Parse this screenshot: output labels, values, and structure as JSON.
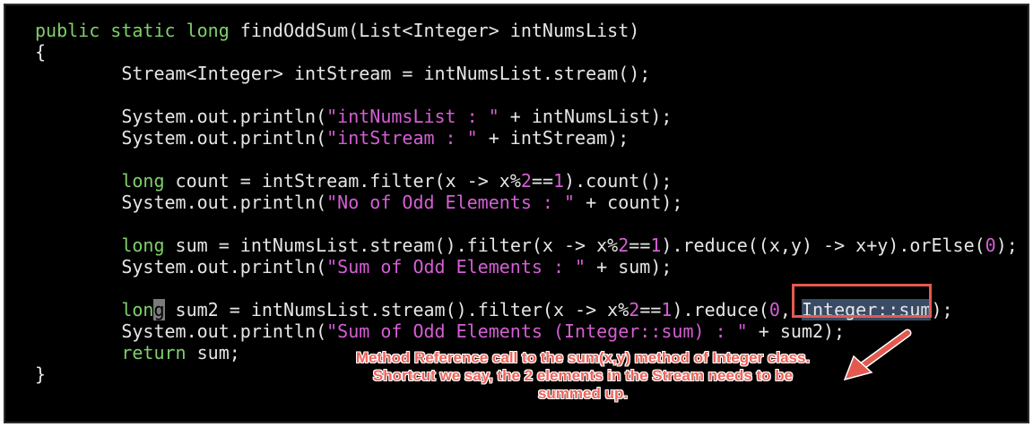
{
  "code_lines": [
    [
      {
        "t": "public static long ",
        "c": "kw"
      },
      {
        "t": "findOddSum(List<Integer> intNumsList)"
      }
    ],
    [
      {
        "t": "{"
      }
    ],
    [
      {
        "t": "        Stream<Integer> intStream = intNumsList.stream();"
      }
    ],
    [],
    [
      {
        "t": "        System.out.println("
      },
      {
        "t": "\"intNumsList : \"",
        "c": "str"
      },
      {
        "t": " + intNumsList);"
      }
    ],
    [
      {
        "t": "        System.out.println("
      },
      {
        "t": "\"intStream : \"",
        "c": "str"
      },
      {
        "t": " + intStream);"
      }
    ],
    [],
    [
      {
        "t": "        "
      },
      {
        "t": "long",
        "c": "kw"
      },
      {
        "t": " count = intStream.filter(x -> x%"
      },
      {
        "t": "2",
        "c": "num"
      },
      {
        "t": "=="
      },
      {
        "t": "1",
        "c": "num"
      },
      {
        "t": ").count();"
      }
    ],
    [
      {
        "t": "        System.out.println("
      },
      {
        "t": "\"No of Odd Elements : \"",
        "c": "str"
      },
      {
        "t": " + count);"
      }
    ],
    [],
    [
      {
        "t": "        "
      },
      {
        "t": "long",
        "c": "kw"
      },
      {
        "t": " sum = intNumsList.stream().filter(x -> x%"
      },
      {
        "t": "2",
        "c": "num"
      },
      {
        "t": "=="
      },
      {
        "t": "1",
        "c": "num"
      },
      {
        "t": ").reduce((x,y) -> x+y).orElse("
      },
      {
        "t": "0",
        "c": "num"
      },
      {
        "t": ");"
      }
    ],
    [
      {
        "t": "        System.out.println("
      },
      {
        "t": "\"Sum of Odd Elements : \"",
        "c": "str"
      },
      {
        "t": " + sum);"
      }
    ],
    [],
    [
      {
        "t": "        "
      },
      {
        "t": "lon",
        "c": "kw"
      },
      {
        "t": "g",
        "c": "cursor"
      },
      {
        "t": " sum2 = intNumsList.stream().filter(x -> x%"
      },
      {
        "t": "2",
        "c": "num"
      },
      {
        "t": "=="
      },
      {
        "t": "1",
        "c": "num"
      },
      {
        "t": ").reduce("
      },
      {
        "t": "0",
        "c": "num"
      },
      {
        "t": ", "
      },
      {
        "t": "Integer::sum",
        "c": "sel"
      },
      {
        "t": ");"
      }
    ],
    [
      {
        "t": "        System.out.println("
      },
      {
        "t": "\"Sum of Odd Elements (Integer::sum) : \"",
        "c": "str"
      },
      {
        "t": " + sum2);"
      }
    ],
    [
      {
        "t": "        "
      },
      {
        "t": "return",
        "c": "kw"
      },
      {
        "t": " sum;"
      }
    ],
    [
      {
        "t": "}"
      }
    ]
  ],
  "callout": {
    "line1": "Method Reference call to the sum(x,y) method of Integer class.",
    "line2": "Shortcut we say, the 2 elements in the Stream needs to be",
    "line3": "summed up."
  },
  "colors": {
    "background": "#000000",
    "keyword": "#7fcf6a",
    "string": "#d45fd3",
    "annotation": "#e4594f"
  }
}
